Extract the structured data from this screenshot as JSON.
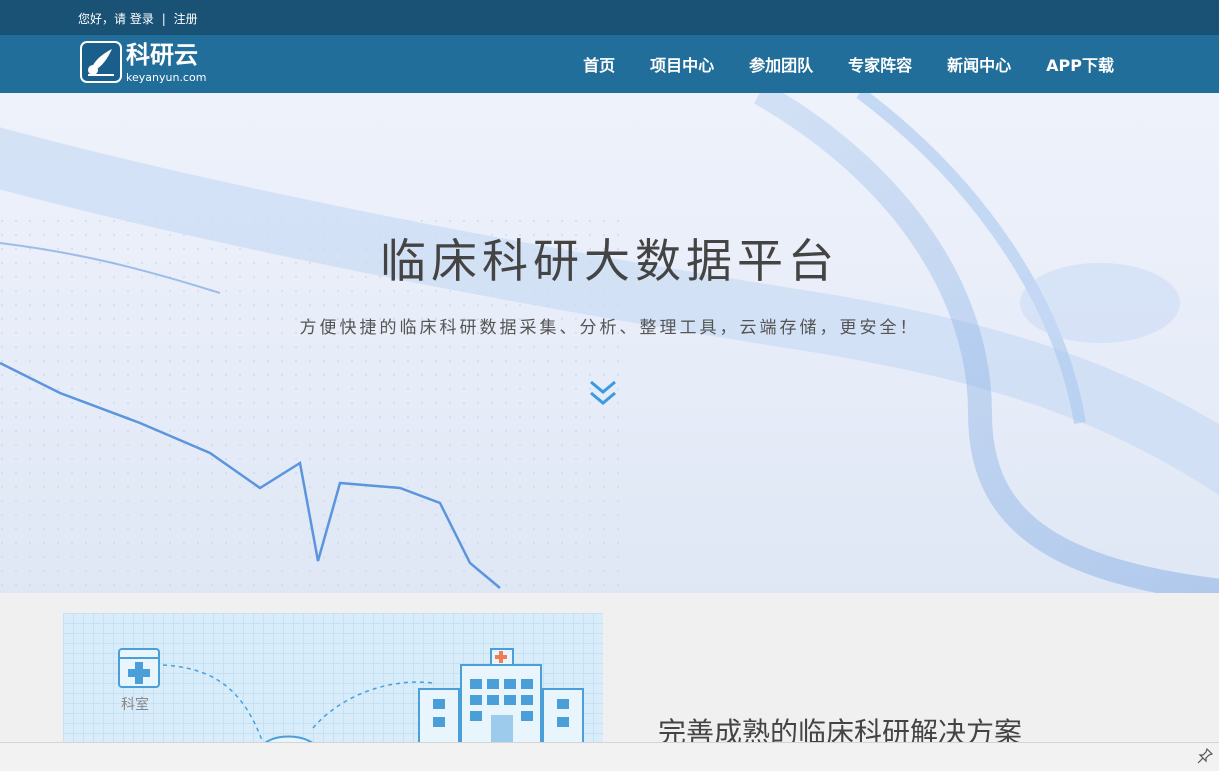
{
  "topbar": {
    "greeting": "您好，请",
    "login": "登录",
    "separator": "|",
    "register": "注册"
  },
  "brand": {
    "name": "科研云",
    "domain": "keyanyun.com"
  },
  "nav": {
    "items": [
      "首页",
      "项目中心",
      "参加团队",
      "专家阵容",
      "新闻中心",
      "APP下载"
    ]
  },
  "hero": {
    "title": "临床科研大数据平台",
    "subtitle": "方便快捷的临床科研数据采集、分析、整理工具，云端存储，更安全！",
    "arrow_icon": "double-chevron-down-icon"
  },
  "section": {
    "illustration_label": "科室",
    "title": "完善成熟的临床科研解决方案"
  },
  "colors": {
    "topbar": "#1a5276",
    "navbar": "#226e9a",
    "accent": "#3b9be0"
  }
}
